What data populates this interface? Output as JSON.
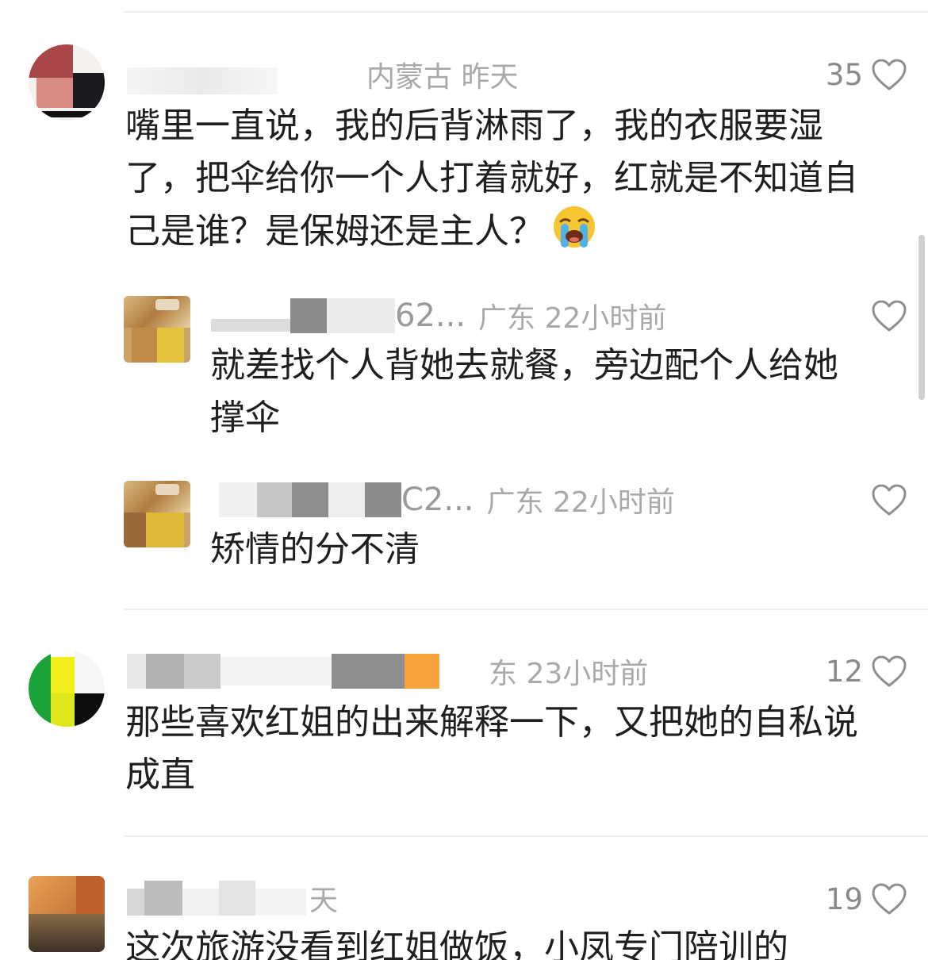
{
  "comments": [
    {
      "username": "",
      "location_time": "内蒙古 昨天",
      "likes": "35",
      "text": "嘴里一直说，我的后背淋雨了，我的衣服要湿了，把伞给你一个人打着就好，红就是不知道自己是谁？是保姆还是主人？",
      "emoji": "loudly-crying-face",
      "replies": [
        {
          "username": "62...",
          "location_time": "广东 22小时前",
          "text": "就差找个人背她去就餐，旁边配个人给她撑伞"
        },
        {
          "username": "C2...",
          "location_time": "广东 22小时前",
          "text": "矫情的分不清"
        }
      ]
    },
    {
      "username": "",
      "location_time": "东 23小时前",
      "likes": "12",
      "text": "那些喜欢红姐的出来解释一下，又把她的自私说成直"
    },
    {
      "username": "",
      "location_time": "天",
      "likes": "19",
      "text": "这次旅游没看到红姐做饭，小凤专门陪训的"
    }
  ],
  "colors": {
    "text": "#1f1f1f",
    "meta": "#a9a9a9",
    "divider": "#eeeeee"
  }
}
